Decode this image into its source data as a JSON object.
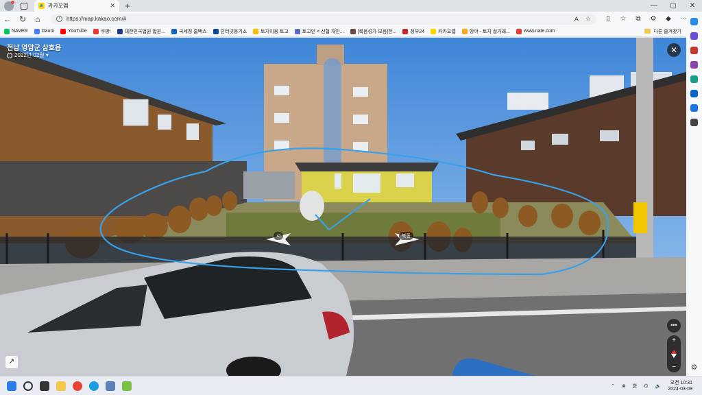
{
  "browser": {
    "tab_title": "카카오맵",
    "url": "https://map.kakao.com/#",
    "read_aloud": "A",
    "bookmarks": [
      {
        "label": "NAVER",
        "color": "#03c75a"
      },
      {
        "label": "Daum",
        "color": "#4a7cf6"
      },
      {
        "label": "YouTube",
        "color": "#ff0000"
      },
      {
        "label": "쿠팡!",
        "color": "#e53935"
      },
      {
        "label": "대한민국법원 법원...",
        "color": "#1e3a8a"
      },
      {
        "label": "국세청 홈택스",
        "color": "#1565c0"
      },
      {
        "label": "인터넷등기소",
        "color": "#0d47a1"
      },
      {
        "label": "토지이용 토고",
        "color": "#fbbc04"
      },
      {
        "label": "토고인 < 신협 개인...",
        "color": "#5c6bc0"
      },
      {
        "label": "[복음성가 모음]한...",
        "color": "#6d4c41"
      },
      {
        "label": "정부24",
        "color": "#c62828"
      },
      {
        "label": "카카오맵",
        "color": "#ffd800"
      },
      {
        "label": "땅야 - 토지 실거래...",
        "color": "#f9a825"
      },
      {
        "label": "www.nate.com",
        "color": "#e53935"
      }
    ],
    "bookmark_folder": "다른 즐겨찾기"
  },
  "roadview": {
    "location_title": "전남 영암군 삼호읍",
    "capture_date": "2022년 02월",
    "direction_labels": [
      "서",
      "북동"
    ],
    "close_label": "✕",
    "more_label": "•••",
    "zoom_in": "+",
    "zoom_out": "−",
    "expand_label": "↗"
  },
  "taskbar": {
    "ime_lang": "한",
    "time_period": "오전 10:31",
    "date": "2024-03-09"
  },
  "colors": {
    "sky": "#7fb4ea",
    "annotation": "#3aa0e8",
    "kakao": "#ffd800"
  }
}
